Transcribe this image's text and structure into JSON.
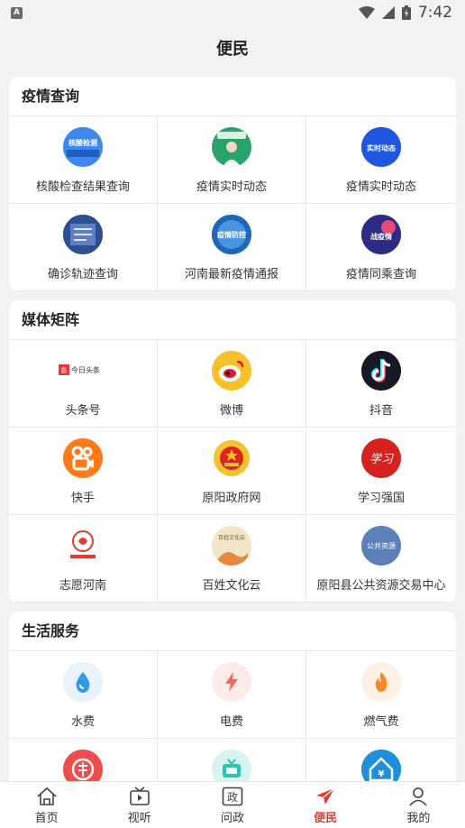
{
  "status_bar": {
    "time": "7:42",
    "app_badge": "A"
  },
  "header": {
    "title": "便民"
  },
  "sections": [
    {
      "title": "疫情查询",
      "items": [
        {
          "label": "核酸检查结果查询",
          "icon": "nucleic-test-icon",
          "icon_text": "核酸检测"
        },
        {
          "label": "疫情实时动态",
          "icon": "doctor-icon",
          "icon_text": ""
        },
        {
          "label": "疫情实时动态",
          "icon": "realtime-update-icon",
          "icon_text": "实时动态"
        },
        {
          "label": "确诊轨迹查询",
          "icon": "trajectory-icon",
          "icon_text": ""
        },
        {
          "label": "河南最新疫情通报",
          "icon": "epidemic-bulletin-icon",
          "icon_text": "疫情防控"
        },
        {
          "label": "疫情同乘查询",
          "icon": "co-passenger-icon",
          "icon_text": "战疫情"
        }
      ]
    },
    {
      "title": "媒体矩阵",
      "items": [
        {
          "label": "头条号",
          "icon": "toutiao-icon",
          "icon_text": "今日头条"
        },
        {
          "label": "微博",
          "icon": "weibo-icon",
          "icon_text": ""
        },
        {
          "label": "抖音",
          "icon": "douyin-icon",
          "icon_text": ""
        },
        {
          "label": "快手",
          "icon": "kuaishou-icon",
          "icon_text": ""
        },
        {
          "label": "原阳政府网",
          "icon": "government-emblem-icon",
          "icon_text": ""
        },
        {
          "label": "学习强国",
          "icon": "xuexi-icon",
          "icon_text": "学习"
        },
        {
          "label": "志愿河南",
          "icon": "volunteer-icon",
          "icon_text": ""
        },
        {
          "label": "百姓文化云",
          "icon": "culture-cloud-icon",
          "icon_text": "百姓文化云"
        },
        {
          "label": "原阳县公共资源交易中心",
          "icon": "public-resource-icon",
          "icon_text": "公共资源"
        }
      ]
    },
    {
      "title": "生活服务",
      "items": [
        {
          "label": "水费",
          "icon": "water-drop-icon",
          "icon_text": ""
        },
        {
          "label": "电费",
          "icon": "lightning-icon",
          "icon_text": ""
        },
        {
          "label": "燃气费",
          "icon": "flame-icon",
          "icon_text": ""
        },
        {
          "label": "",
          "icon": "loan-icon",
          "icon_text": ""
        },
        {
          "label": "",
          "icon": "tv-icon",
          "icon_text": ""
        },
        {
          "label": "",
          "icon": "housing-fund-icon",
          "icon_text": ""
        }
      ]
    }
  ],
  "tabbar": [
    {
      "label": "首页",
      "icon": "home-icon",
      "active": false
    },
    {
      "label": "视听",
      "icon": "video-icon",
      "active": false
    },
    {
      "label": "问政",
      "icon": "zheng-icon",
      "active": false
    },
    {
      "label": "便民",
      "icon": "paper-plane-icon",
      "active": true
    },
    {
      "label": "我的",
      "icon": "person-icon",
      "active": false
    }
  ],
  "colors": {
    "accent": "#e23a2f",
    "background": "#f2f2f2"
  }
}
